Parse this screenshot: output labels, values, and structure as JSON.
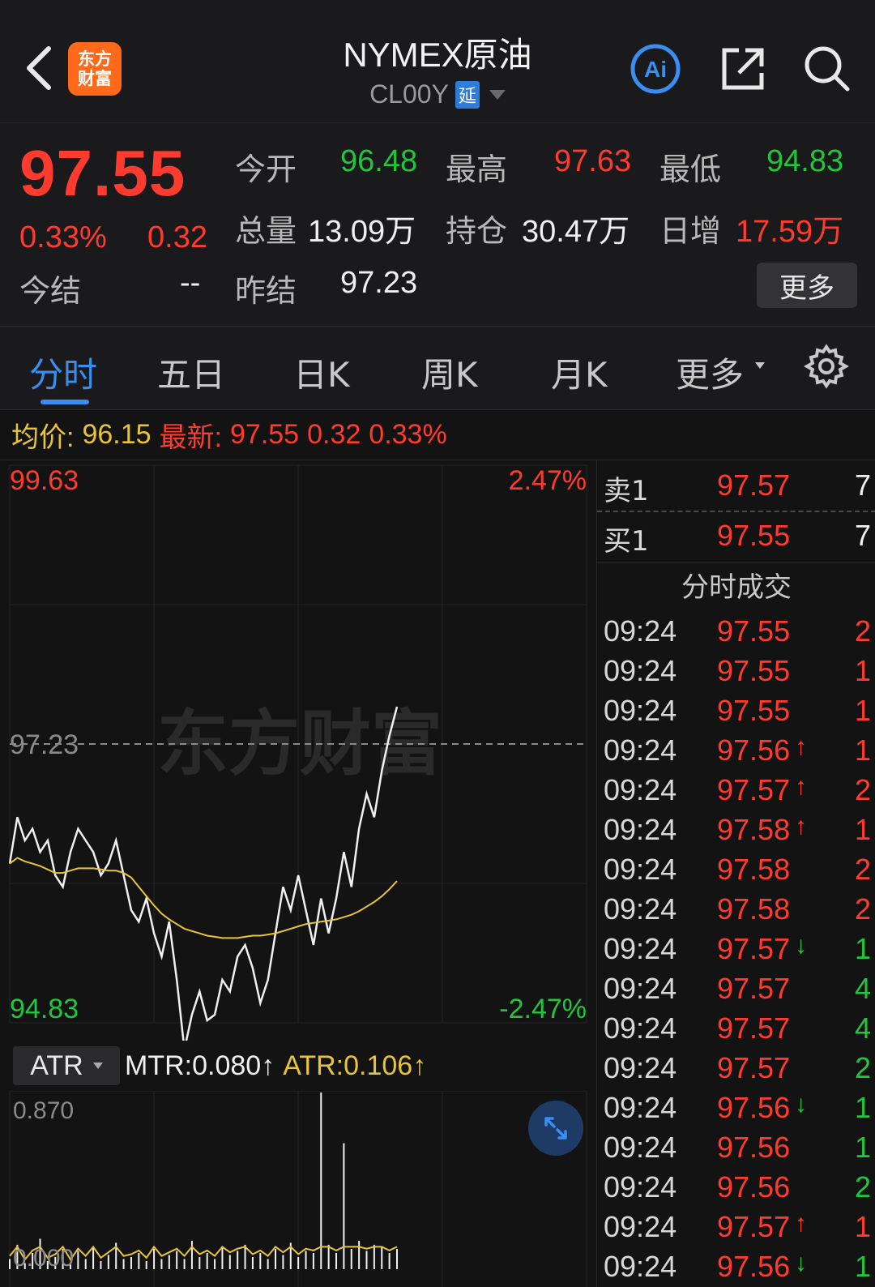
{
  "header": {
    "title": "NYMEX原油",
    "code": "CL00Y",
    "delay_badge": "延",
    "logo_line1": "东方",
    "logo_line2": "财富"
  },
  "quote": {
    "price": "97.55",
    "pct": "0.33%",
    "change": "0.32",
    "open_label": "今开",
    "open": "96.48",
    "high_label": "最高",
    "high": "97.63",
    "low_label": "最低",
    "low": "94.83",
    "volume_label": "总量",
    "volume": "13.09万",
    "oi_label": "持仓",
    "oi": "30.47万",
    "oi_inc_label": "日增",
    "oi_inc": "17.59万",
    "settle_label": "今结",
    "settle": "--",
    "prev_settle_label": "昨结",
    "prev_settle": "97.23",
    "more_label": "更多"
  },
  "tabs": [
    "分时",
    "五日",
    "日K",
    "周K",
    "月K",
    "更多"
  ],
  "avg_bar": {
    "avg_label": "均价:",
    "avg": "96.15",
    "latest_label": "最新:",
    "latest": "97.55",
    "change": "0.32",
    "pct": "0.33%"
  },
  "chart_data": {
    "type": "line",
    "y_max_label": "99.63",
    "y_min_label": "94.83",
    "y_mid_label": "97.23",
    "pct_top_label": "2.47%",
    "pct_bottom_label": "-2.47%",
    "ylim": [
      94.83,
      99.63
    ],
    "reference_line": 97.23,
    "watermark": "东方财富",
    "series": [
      {
        "values": [
          96.2,
          96.6,
          96.4,
          96.5,
          96.3,
          96.4,
          96.1,
          96.0,
          96.3,
          96.5,
          96.4,
          96.3,
          96.1,
          96.2,
          96.4,
          96.1,
          95.8,
          95.7,
          95.9,
          95.6,
          95.4,
          95.7,
          95.2,
          94.6,
          94.9,
          95.1,
          94.85,
          94.9,
          95.2,
          95.1,
          95.4,
          95.5,
          95.3,
          95.0,
          95.2,
          95.6,
          96.0,
          95.8,
          96.1,
          95.8,
          95.5,
          95.9,
          95.6,
          95.9,
          96.3,
          96.0,
          96.5,
          96.8,
          96.6,
          97.0,
          97.3,
          97.55
        ]
      },
      {
        "values": [
          96.2,
          96.25,
          96.22,
          96.2,
          96.18,
          96.15,
          96.12,
          96.12,
          96.14,
          96.16,
          96.16,
          96.16,
          96.15,
          96.14,
          96.14,
          96.12,
          96.08,
          96.0,
          95.92,
          95.84,
          95.77,
          95.72,
          95.68,
          95.64,
          95.62,
          95.6,
          95.58,
          95.57,
          95.56,
          95.56,
          95.56,
          95.57,
          95.58,
          95.58,
          95.59,
          95.6,
          95.62,
          95.64,
          95.66,
          95.68,
          95.69,
          95.7,
          95.71,
          95.72,
          95.74,
          95.76,
          95.79,
          95.83,
          95.87,
          95.92,
          95.98,
          96.05
        ]
      }
    ]
  },
  "atr": {
    "select": "ATR",
    "mtr": "MTR:0.080↑",
    "atr": "ATR:0.106↑",
    "y_max_label": "0.870",
    "y_min_label": "0.000",
    "ylim": [
      0,
      0.87
    ],
    "values": [
      0.05,
      0.12,
      0.03,
      0.08,
      0.15,
      0.04,
      0.06,
      0.1,
      0.03,
      0.09,
      0.05,
      0.11,
      0.04,
      0.07,
      0.13,
      0.05,
      0.06,
      0.08,
      0.04,
      0.1,
      0.05,
      0.07,
      0.09,
      0.05,
      0.14,
      0.06,
      0.08,
      0.05,
      0.11,
      0.07,
      0.09,
      0.12,
      0.06,
      0.08,
      0.05,
      0.1,
      0.07,
      0.13,
      0.06,
      0.09,
      0.08,
      0.87,
      0.12,
      0.08,
      0.62,
      0.1,
      0.14,
      0.09,
      0.12,
      0.11,
      0.08,
      0.1
    ]
  },
  "order_book": {
    "ask_label": "卖1",
    "ask_price": "97.57",
    "ask_vol": "7",
    "bid_label": "买1",
    "bid_price": "97.55",
    "bid_vol": "7"
  },
  "ticks_title": "分时成交",
  "ticks": [
    {
      "time": "09:24",
      "price": "97.55",
      "arrow": "",
      "vol": "2",
      "vol_color": "#ff3b30"
    },
    {
      "time": "09:24",
      "price": "97.55",
      "arrow": "",
      "vol": "1",
      "vol_color": "#ff3b30"
    },
    {
      "time": "09:24",
      "price": "97.55",
      "arrow": "",
      "vol": "1",
      "vol_color": "#ff3b30"
    },
    {
      "time": "09:24",
      "price": "97.56",
      "arrow": "↑",
      "vol": "1",
      "vol_color": "#ff3b30"
    },
    {
      "time": "09:24",
      "price": "97.57",
      "arrow": "↑",
      "vol": "2",
      "vol_color": "#ff3b30"
    },
    {
      "time": "09:24",
      "price": "97.58",
      "arrow": "↑",
      "vol": "1",
      "vol_color": "#ff3b30"
    },
    {
      "time": "09:24",
      "price": "97.58",
      "arrow": "",
      "vol": "2",
      "vol_color": "#ff3b30"
    },
    {
      "time": "09:24",
      "price": "97.58",
      "arrow": "",
      "vol": "2",
      "vol_color": "#ff3b30"
    },
    {
      "time": "09:24",
      "price": "97.57",
      "arrow": "↓",
      "vol": "1",
      "vol_color": "#22c53b"
    },
    {
      "time": "09:24",
      "price": "97.57",
      "arrow": "",
      "vol": "4",
      "vol_color": "#22c53b"
    },
    {
      "time": "09:24",
      "price": "97.57",
      "arrow": "",
      "vol": "4",
      "vol_color": "#22c53b"
    },
    {
      "time": "09:24",
      "price": "97.57",
      "arrow": "",
      "vol": "2",
      "vol_color": "#22c53b"
    },
    {
      "time": "09:24",
      "price": "97.56",
      "arrow": "↓",
      "vol": "1",
      "vol_color": "#22c53b"
    },
    {
      "time": "09:24",
      "price": "97.56",
      "arrow": "",
      "vol": "1",
      "vol_color": "#22c53b"
    },
    {
      "time": "09:24",
      "price": "97.56",
      "arrow": "",
      "vol": "2",
      "vol_color": "#22c53b"
    },
    {
      "time": "09:24",
      "price": "97.57",
      "arrow": "↑",
      "vol": "1",
      "vol_color": "#ff3b30"
    },
    {
      "time": "09:24",
      "price": "97.56",
      "arrow": "↓",
      "vol": "1",
      "vol_color": "#22c53b"
    }
  ],
  "colors": {
    "up": "#ff3b30",
    "down": "#22c53b",
    "accent": "#3a8ef2",
    "avg_line": "#e8c43a"
  }
}
